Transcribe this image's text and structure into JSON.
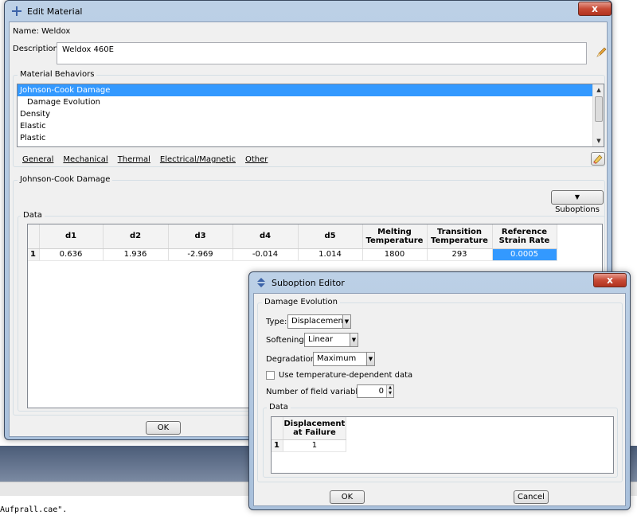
{
  "desktop": {
    "status_text": "Aufprall.cae\"."
  },
  "edit_material": {
    "title": "Edit Material",
    "close_label": "x",
    "name_label": "Name:",
    "name_value": "Weldox",
    "description_label": "Description:",
    "description_value": "Weldox 460E",
    "behaviors_group": "Material Behaviors",
    "behaviors": [
      "Johnson-Cook Damage",
      "Damage Evolution",
      "Density",
      "Elastic",
      "Plastic"
    ],
    "menus": [
      "General",
      "Mechanical",
      "Thermal",
      "Electrical/Magnetic",
      "Other"
    ],
    "section_title": "Johnson-Cook Damage",
    "suboptions_label": "Suboptions",
    "data_group": "Data",
    "table": {
      "headers": [
        "d1",
        "d2",
        "d3",
        "d4",
        "d5",
        "Melting Temperature",
        "Transition Temperature",
        "Reference Strain Rate"
      ],
      "rows": [
        {
          "num": "1",
          "cells": [
            "0.636",
            "1.936",
            "-2.969",
            "-0.014",
            "1.014",
            "1800",
            "293",
            "0.0005"
          ]
        }
      ]
    },
    "ok_label": "OK"
  },
  "suboption_editor": {
    "title": "Suboption Editor",
    "close_label": "x",
    "group_title": "Damage Evolution",
    "type_label": "Type:",
    "type_value": "Displacement",
    "softening_label": "Softening:",
    "softening_value": "Linear",
    "degradation_label": "Degradation:",
    "degradation_value": "Maximum",
    "temp_checkbox_label": "Use temperature-dependent data",
    "field_vars_label": "Number of field variables:",
    "field_vars_value": "0",
    "data_group": "Data",
    "table": {
      "header_line1": "Displacement",
      "header_line2": "at Failure",
      "row_num": "1",
      "row_value": "1"
    },
    "ok_label": "OK",
    "cancel_label": "Cancel"
  },
  "colors": {
    "selection": "#3399ff",
    "close_button": "#c74a35",
    "title_bar": "#bcd0e6"
  }
}
